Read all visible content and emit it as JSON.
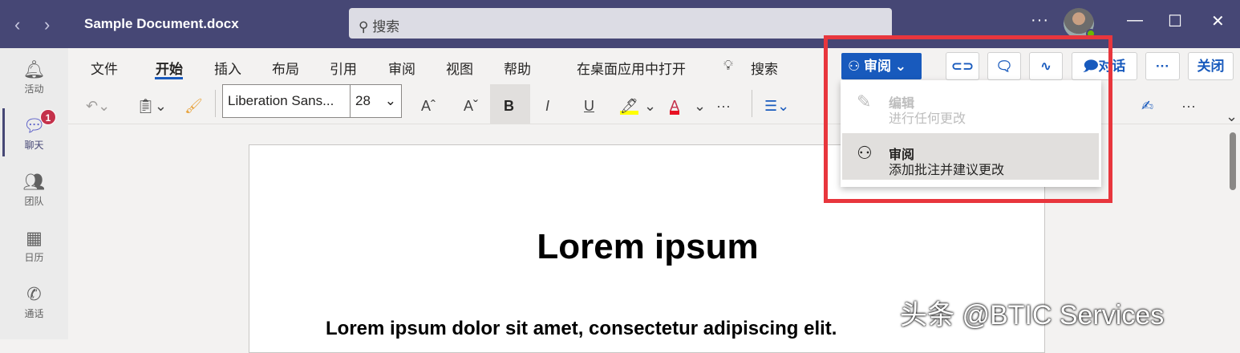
{
  "titlebar": {
    "back": "‹",
    "forward": "›",
    "title": "Sample Document.docx",
    "search_placeholder": "搜索",
    "more": "···",
    "minimize": "—",
    "maximize": "☐",
    "close": "✕"
  },
  "rail": {
    "items": [
      {
        "label": "活动",
        "icon": "🔔"
      },
      {
        "label": "聊天",
        "icon": "💬",
        "badge": "1"
      },
      {
        "label": "团队",
        "icon": "👥"
      },
      {
        "label": "日历",
        "icon": "▦"
      },
      {
        "label": "通话",
        "icon": "✆"
      }
    ]
  },
  "ribbon": {
    "tabs": [
      "文件",
      "开始",
      "插入",
      "布局",
      "引用",
      "审阅",
      "视图",
      "帮助",
      "在桌面应用中打开"
    ],
    "tell_me": "搜索",
    "font": "Liberation Sans...",
    "size": "28",
    "more": "···"
  },
  "actions": {
    "mode": "审阅",
    "chat": "对话",
    "more": "···",
    "close": "关闭"
  },
  "dropdown": {
    "items": [
      {
        "title": "编辑",
        "desc": "进行任何更改",
        "disabled": true
      },
      {
        "title": "审阅",
        "desc": "添加批注并建议更改",
        "selected": true
      }
    ]
  },
  "document": {
    "heading": "Lorem ipsum",
    "subheading": "Lorem ipsum dolor sit amet, consectetur adipiscing elit."
  },
  "watermark": "头条 @BTIC Services",
  "colors": {
    "titlebar": "#464775",
    "accent": "#185abd",
    "highlight_box": "#e8363d"
  }
}
